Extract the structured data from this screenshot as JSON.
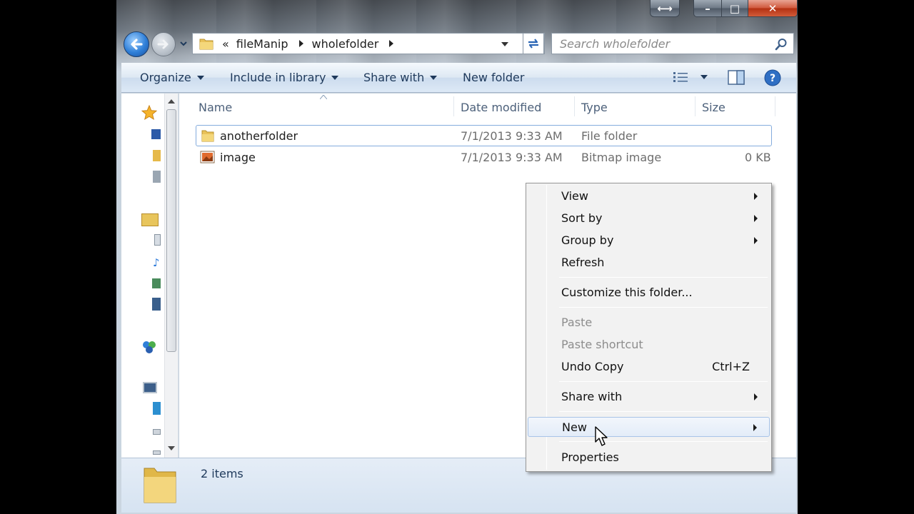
{
  "window": {
    "caption": {
      "resize_glyph": "⟷",
      "minimize_glyph": "–",
      "maximize_glyph": "□",
      "close_glyph": "✕"
    }
  },
  "address_bar": {
    "overflow": "«",
    "segments": [
      "fileManip",
      "wholefolder"
    ]
  },
  "search": {
    "placeholder": "Search wholefolder"
  },
  "toolbar": {
    "organize": "Organize",
    "include_in_library": "Include in library",
    "share_with": "Share with",
    "new_folder": "New folder"
  },
  "columns": {
    "name": "Name",
    "date_modified": "Date modified",
    "type": "Type",
    "size": "Size"
  },
  "files": [
    {
      "name": "anotherfolder",
      "date_modified": "7/1/2013 9:33 AM",
      "type": "File folder",
      "size": "",
      "icon": "folder-icon",
      "selected": true
    },
    {
      "name": "image",
      "date_modified": "7/1/2013 9:33 AM",
      "type": "Bitmap image",
      "size": "0 KB",
      "icon": "bitmap-image-icon",
      "selected": false
    }
  ],
  "status": {
    "item_count": "2 items"
  },
  "context_menu": {
    "view": "View",
    "sort_by": "Sort by",
    "group_by": "Group by",
    "refresh": "Refresh",
    "customize": "Customize this folder...",
    "paste": "Paste",
    "paste_shortcut": "Paste shortcut",
    "undo_copy": "Undo Copy",
    "undo_copy_shortcut": "Ctrl+Z",
    "share_with": "Share with",
    "new": "New",
    "properties": "Properties"
  },
  "colors": {
    "accent": "#1e395b",
    "selection_border": "#84acdd",
    "close_button": "#c8401f"
  }
}
